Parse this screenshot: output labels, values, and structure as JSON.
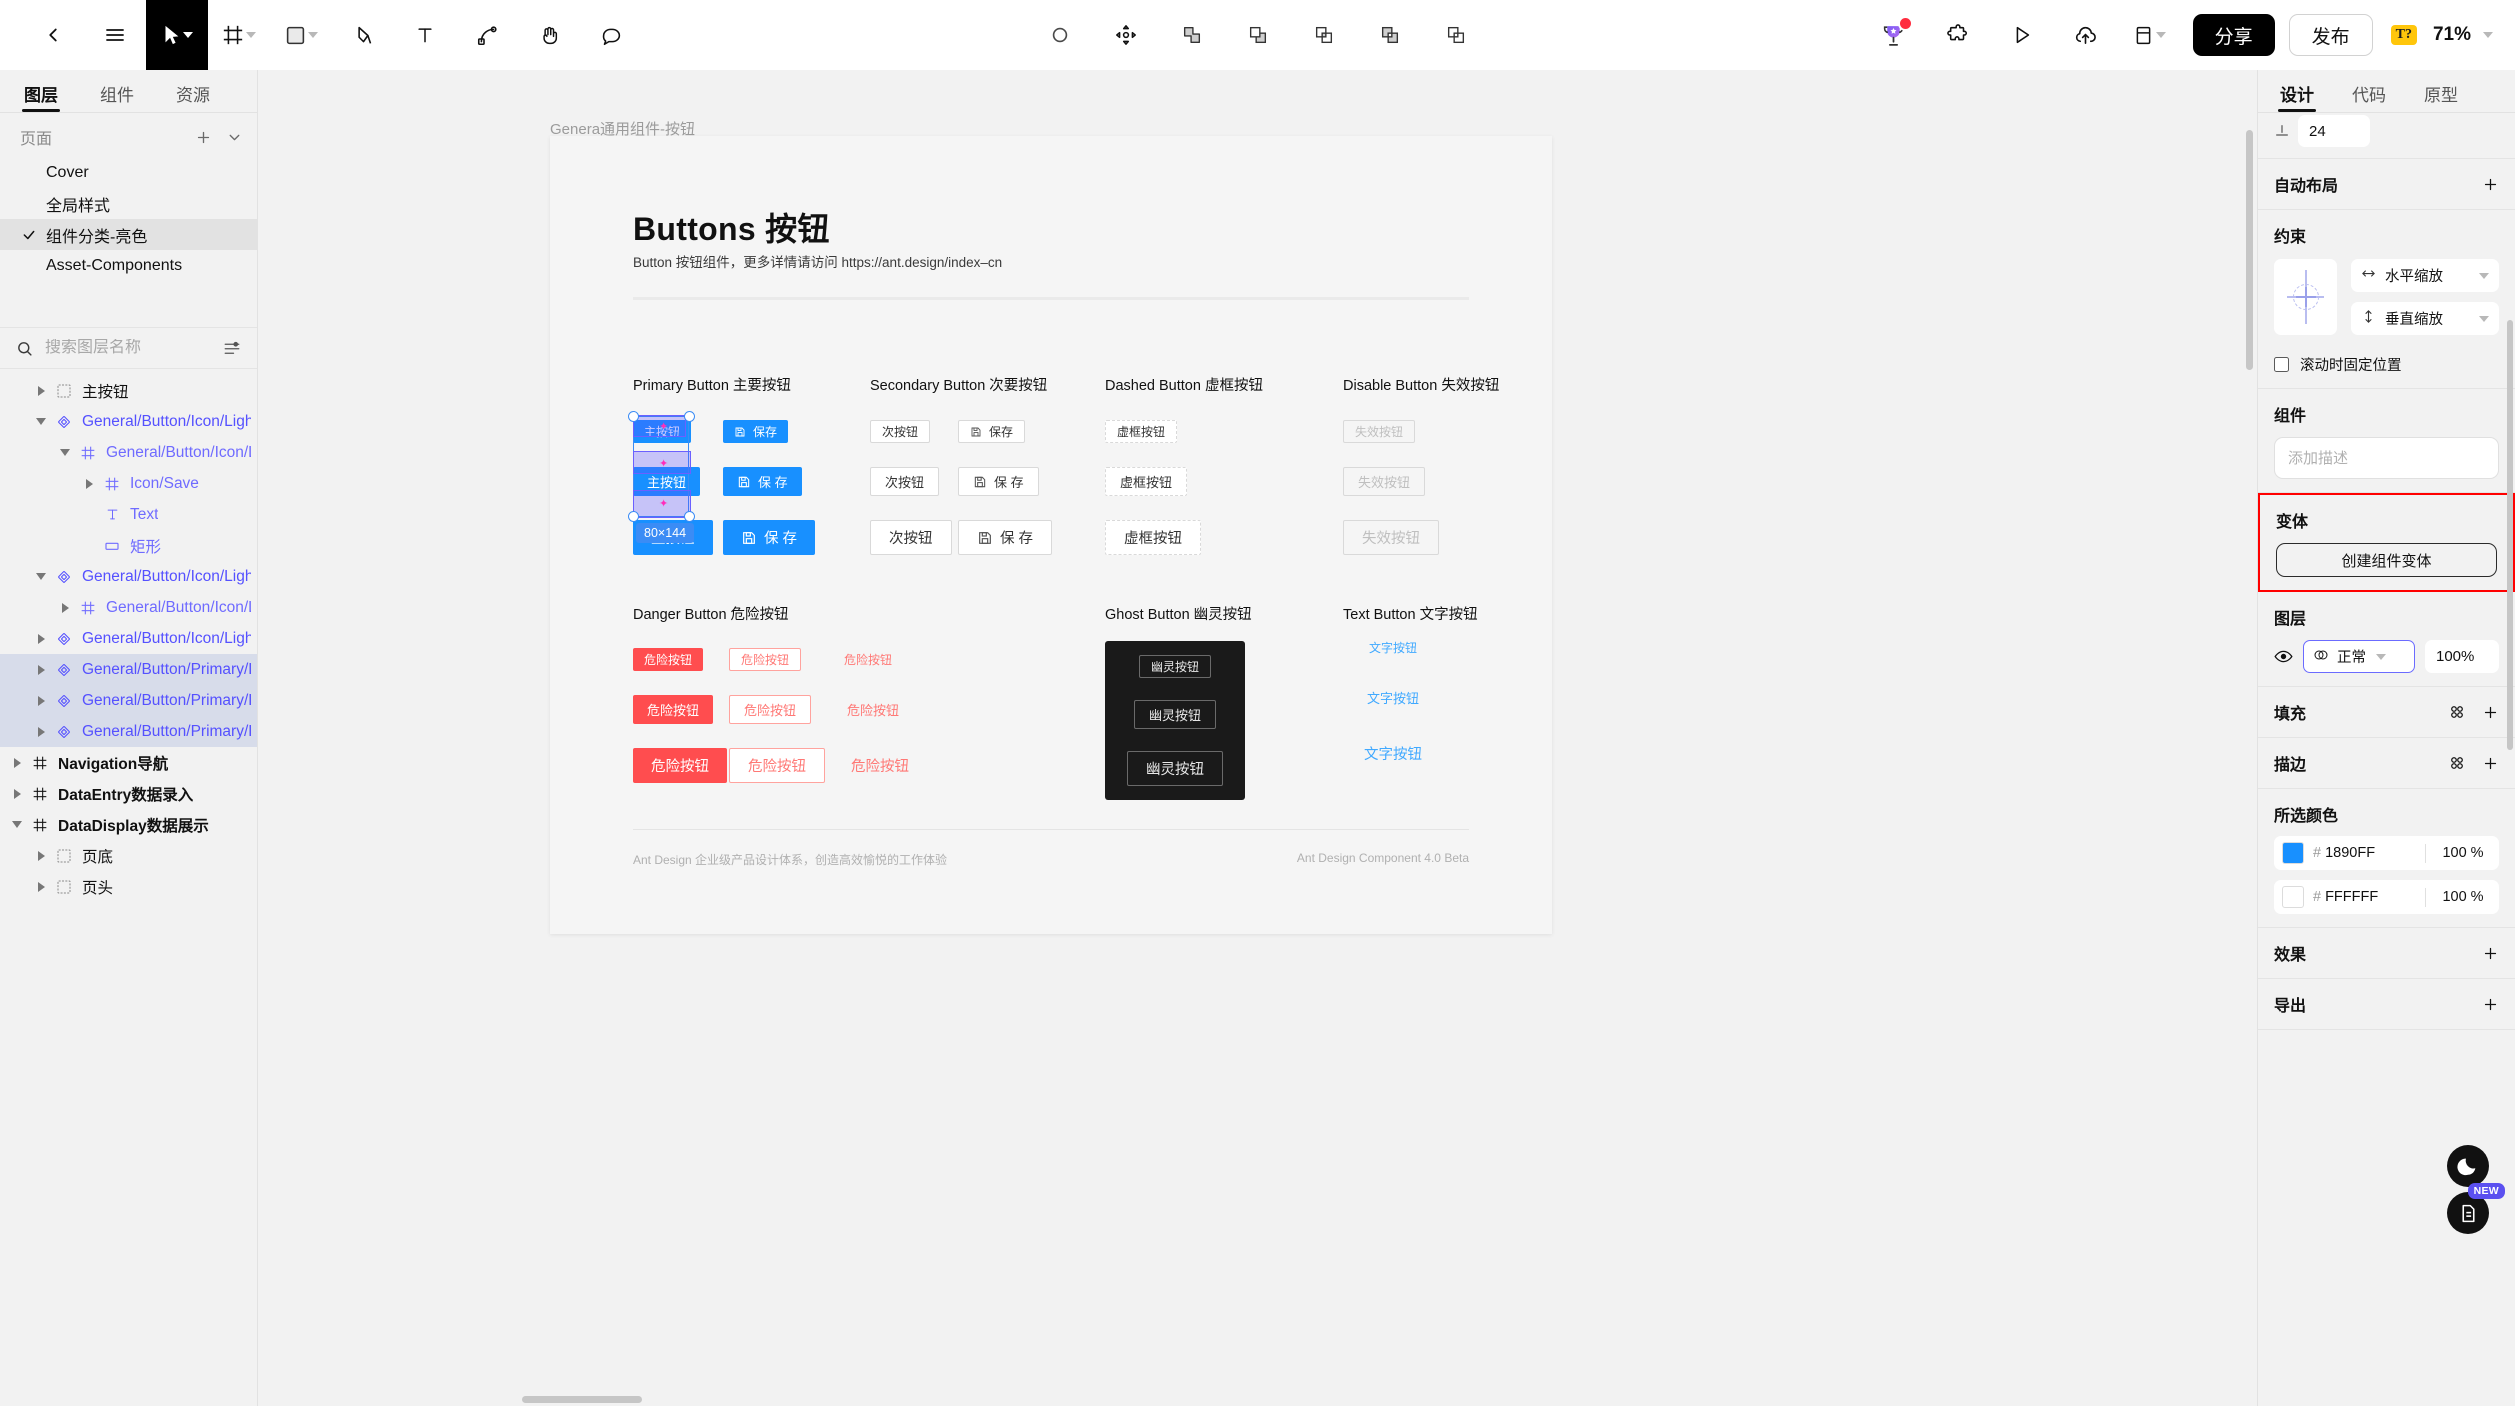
{
  "toolbar": {
    "left_tools": [
      {
        "name": "back-button",
        "icon": "chevron-left-icon"
      },
      {
        "name": "menu-button",
        "icon": "hamburger-icon"
      },
      {
        "name": "move-tool",
        "icon": "cursor-arrow-icon",
        "active": true,
        "caret": true
      },
      {
        "name": "frame-tool",
        "icon": "frame-icon",
        "caret": true
      },
      {
        "name": "shape-tool",
        "icon": "square-icon",
        "caret": true
      },
      {
        "name": "pen-tool",
        "icon": "pen-icon"
      },
      {
        "name": "text-tool",
        "icon": "text-t-icon"
      },
      {
        "name": "path-tool",
        "icon": "path-node-icon"
      },
      {
        "name": "hand-tool",
        "icon": "hand-icon"
      },
      {
        "name": "comment-tool",
        "icon": "comment-bubble-icon"
      }
    ],
    "center_tools": [
      {
        "name": "mask-tool",
        "icon": "circle-mask-icon"
      },
      {
        "name": "transform-tool",
        "icon": "move-arrows-icon"
      },
      {
        "name": "boolean-union",
        "icon": "union-icon"
      },
      {
        "name": "boolean-subtract",
        "icon": "subtract-icon"
      },
      {
        "name": "boolean-intersect",
        "icon": "intersect-icon"
      },
      {
        "name": "boolean-exclude",
        "icon": "exclude-icon"
      },
      {
        "name": "boolean-flatten",
        "icon": "flatten-icon"
      }
    ],
    "right_tools": [
      {
        "name": "rewards-button",
        "icon": "trophy-icon",
        "has_badge": true
      },
      {
        "name": "plugins-button",
        "icon": "puzzle-icon"
      },
      {
        "name": "preview-button",
        "icon": "play-icon"
      },
      {
        "name": "upload-button",
        "icon": "cloud-upload-icon"
      },
      {
        "name": "layout-grid-button",
        "icon": "panel-icon",
        "caret": true
      }
    ],
    "share_label": "分享",
    "publish_label": "发布",
    "translate_badge": "T?",
    "zoom_level": "71%"
  },
  "left_panel": {
    "tabs": [
      {
        "label": "图层",
        "active": true
      },
      {
        "label": "组件",
        "active": false
      },
      {
        "label": "资源",
        "active": false
      }
    ],
    "pages_header": "页面",
    "pages": [
      {
        "label": "Cover",
        "selected": false
      },
      {
        "label": "全局样式",
        "selected": false
      },
      {
        "label": "组件分类-亮色",
        "selected": true
      },
      {
        "label": "Asset-Components",
        "selected": false
      }
    ],
    "search_placeholder": "搜索图层名称",
    "layers": [
      {
        "label": "主按钮",
        "indent": 1,
        "arrow": "right",
        "icon": "component-set-icon",
        "style": "dark",
        "selected": false
      },
      {
        "label": "General/Button/Icon/Light/Pr...",
        "indent": 1,
        "arrow": "down",
        "icon": "component-icon",
        "style": "comp",
        "selected": false
      },
      {
        "label": "General/Button/Icon/Lig...",
        "indent": 2,
        "arrow": "down",
        "icon": "frame-icon",
        "style": "inst",
        "selected": false
      },
      {
        "label": "Icon/Save",
        "indent": 3,
        "arrow": "right",
        "icon": "frame-icon",
        "style": "inst",
        "selected": false
      },
      {
        "label": "Text",
        "indent": 3,
        "arrow": "none",
        "icon": "text-icon",
        "style": "inst",
        "selected": false
      },
      {
        "label": "矩形",
        "indent": 3,
        "arrow": "none",
        "icon": "rect-icon",
        "style": "inst",
        "selected": false
      },
      {
        "label": "General/Button/Icon/Light/Pr...",
        "indent": 1,
        "arrow": "down",
        "icon": "component-icon",
        "style": "comp",
        "selected": false
      },
      {
        "label": "General/Button/Icon/Lig...",
        "indent": 2,
        "arrow": "right",
        "icon": "frame-icon",
        "style": "inst",
        "selected": false
      },
      {
        "label": "General/Button/Icon/Light/Pr...",
        "indent": 1,
        "arrow": "right",
        "icon": "component-icon",
        "style": "comp",
        "selected": false
      },
      {
        "label": "General/Button/Primary/Ligh...",
        "indent": 1,
        "arrow": "right",
        "icon": "component-icon",
        "style": "comp",
        "selected": true
      },
      {
        "label": "General/Button/Primary/Ligh...",
        "indent": 1,
        "arrow": "right",
        "icon": "component-icon",
        "style": "comp",
        "selected": true
      },
      {
        "label": "General/Button/Primary/Ligh...",
        "indent": 1,
        "arrow": "right",
        "icon": "component-icon",
        "style": "comp",
        "selected": true
      },
      {
        "label": "Navigation导航",
        "indent": 0,
        "arrow": "right",
        "icon": "frame-icon",
        "style": "bold",
        "selected": false
      },
      {
        "label": "DataEntry数据录入",
        "indent": 0,
        "arrow": "right",
        "icon": "frame-icon",
        "style": "bold",
        "selected": false
      },
      {
        "label": "DataDisplay数据展示",
        "indent": 0,
        "arrow": "down",
        "icon": "frame-icon",
        "style": "bold",
        "selected": false
      },
      {
        "label": "页底",
        "indent": 1,
        "arrow": "right",
        "icon": "component-set-icon",
        "style": "dark",
        "selected": false
      },
      {
        "label": "页头",
        "indent": 1,
        "arrow": "right",
        "icon": "component-set-icon",
        "style": "dark",
        "selected": false
      }
    ]
  },
  "canvas": {
    "frame_label": "Genera通用组件-按钮",
    "title": "Buttons 按钮",
    "subtitle": "Button 按钮组件，更多详情请访问 https://ant.design/index–cn",
    "footer_left": "Ant Design 企业级产品设计体系，创造高效愉悦的工作体验",
    "footer_right": "Ant Design Component 4.0 Beta",
    "selection_size": "80×144",
    "sections": [
      {
        "name": "primary",
        "title": "Primary Button 主要按钮"
      },
      {
        "name": "secondary",
        "title": "Secondary Button 次要按钮"
      },
      {
        "name": "dashed",
        "title": "Dashed Button 虚框按钮"
      },
      {
        "name": "disable",
        "title": "Disable Button 失效按钮"
      },
      {
        "name": "danger",
        "title": "Danger Button 危险按钮"
      },
      {
        "name": "ghost",
        "title": "Ghost Button 幽灵按钮"
      },
      {
        "name": "text",
        "title": "Text Button 文字按钮"
      }
    ],
    "labels": {
      "primary": "主按钮",
      "save": "保存",
      "save_wide": "保 存",
      "secondary": "次按钮",
      "dashed": "虚框按钮",
      "disable": "失效按钮",
      "danger": "危险按钮",
      "ghost": "幽灵按钮",
      "text": "文字按钮"
    }
  },
  "right_panel": {
    "tabs": [
      {
        "label": "设计",
        "active": true
      },
      {
        "label": "代码",
        "active": false
      },
      {
        "label": "原型",
        "active": false
      }
    ],
    "corner_radius": "24",
    "auto_layout_title": "自动布局",
    "constraints_title": "约束",
    "horizontal_constraint": "水平缩放",
    "vertical_constraint": "垂直缩放",
    "fix_on_scroll": "滚动时固定位置",
    "component_title": "组件",
    "description_placeholder": "添加描述",
    "variants_title": "变体",
    "create_variant_label": "创建组件变体",
    "layer_title": "图层",
    "blend_mode": "正常",
    "layer_opacity": "100%",
    "fill_title": "填充",
    "stroke_title": "描边",
    "selected_colors_title": "所选颜色",
    "selected_colors": [
      {
        "hex": "1890FF",
        "opacity": "100 %",
        "swatch": "#1890ff"
      },
      {
        "hex": "FFFFFF",
        "opacity": "100 %",
        "swatch": "#ffffff"
      }
    ],
    "effects_title": "效果",
    "export_title": "导出",
    "fab_new_badge": "NEW"
  }
}
